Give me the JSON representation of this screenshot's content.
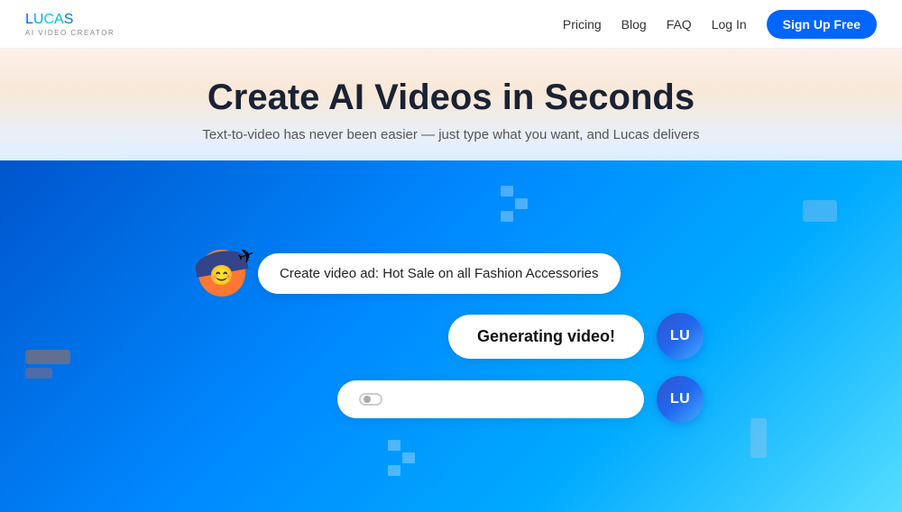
{
  "header": {
    "logo": {
      "text": "LUCAS",
      "subtitle": "AI Video Creator"
    },
    "nav": {
      "items": [
        {
          "id": "pricing",
          "label": "Pricing"
        },
        {
          "id": "blog",
          "label": "Blog"
        },
        {
          "id": "faq",
          "label": "FAQ"
        },
        {
          "id": "login",
          "label": "Log In"
        }
      ],
      "signup_label": "Sign Up Free"
    }
  },
  "hero": {
    "title": "Create AI Videos in Seconds",
    "subtitle": "Text-to-video has never been easier — just type what you want, and Lucas delivers"
  },
  "chat": {
    "user_message": "Create video ad: Hot Sale on all Fashion Accessories",
    "generating_message": "Generating video!",
    "lu_avatar_text": "LU",
    "loading_bubble": "",
    "paper_plane": "✈"
  }
}
